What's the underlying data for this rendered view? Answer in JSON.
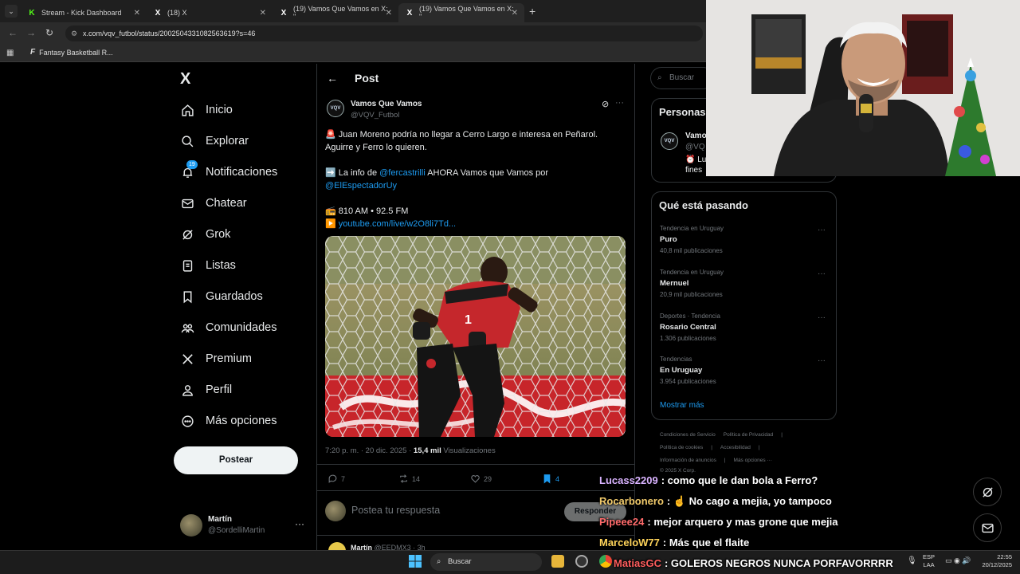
{
  "browser": {
    "tabs": [
      {
        "title": "Stream - Kick Dashboard",
        "favicon": "K"
      },
      {
        "title": "(18) X",
        "favicon": "X"
      },
      {
        "title": "(19) Vamos Que Vamos en X: \"",
        "favicon": "X"
      },
      {
        "title": "(19) Vamos Que Vamos en X: \"",
        "favicon": "X"
      }
    ],
    "url": "x.com/vqv_futbol/status/2002504331082563619?s=46",
    "bookmark": "Fantasy Basketball R..."
  },
  "nav": {
    "logo": "X",
    "items": [
      {
        "label": "Inicio",
        "icon": "home-icon"
      },
      {
        "label": "Explorar",
        "icon": "search-icon"
      },
      {
        "label": "Notificaciones",
        "icon": "bell-icon",
        "badge": "19"
      },
      {
        "label": "Chatear",
        "icon": "mail-icon"
      },
      {
        "label": "Grok",
        "icon": "grok-icon"
      },
      {
        "label": "Listas",
        "icon": "list-icon"
      },
      {
        "label": "Guardados",
        "icon": "bookmark-icon"
      },
      {
        "label": "Comunidades",
        "icon": "communities-icon"
      },
      {
        "label": "Premium",
        "icon": "x-icon"
      },
      {
        "label": "Perfil",
        "icon": "person-icon"
      },
      {
        "label": "Más opciones",
        "icon": "more-circle-icon"
      }
    ],
    "post_button": "Postear",
    "account": {
      "name": "Martín",
      "handle": "@SordelliMartin"
    }
  },
  "post": {
    "header": "Post",
    "author": {
      "name": "Vamos Que Vamos",
      "handle": "@VQV_Futbol",
      "avatar_text": "VQV"
    },
    "line1": "🚨 Juan Moreno podría no llegar a Cerro Largo e interesa en Peñarol.",
    "line2": "Aguirre y Ferro lo quieren.",
    "line3_pre": "➡️ La info de ",
    "line3_link": "@fercastrilli",
    "line3_post": " AHORA Vamos que Vamos por",
    "line4_link": "@ElEspectadorUy",
    "line5": "📻 810 AM • 92.5 FM",
    "line6_pre": "▶️ ",
    "line6_link": "youtube.com/live/w2O8li7Td...",
    "time": "7:20 p. m. · 20 dic. 2025 · ",
    "views_count": "15,4 mil",
    "views_label": " Visualizaciones",
    "replies": "7",
    "reposts": "14",
    "likes": "29",
    "bookmarks": "4",
    "reply_placeholder": "Postea tu respuesta",
    "reply_button": "Responder",
    "next_reply_name": "Martín",
    "next_reply_meta": "@EEDMX3 · 3h"
  },
  "right": {
    "search_placeholder": "Buscar",
    "relevant_title": "Personas",
    "relevant_name": "Vamo",
    "relevant_handle": "@VQ",
    "relevant_line1": "⏰ Lu",
    "relevant_line2": "fines",
    "trends_title": "Qué está pasando",
    "trends": [
      {
        "context": "Tendencia en Uruguay",
        "name": "Puro",
        "count": "40,8 mil publicaciones"
      },
      {
        "context": "Tendencia en Uruguay",
        "name": "Mernuel",
        "count": "20,9 mil publicaciones"
      },
      {
        "context": "Deportes · Tendencia",
        "name": "Rosario Central",
        "count": "1.306 publicaciones"
      },
      {
        "context": "Tendencias",
        "name": "En Uruguay",
        "count": "3.954 publicaciones"
      }
    ],
    "show_more": "Mostrar más",
    "footer1": [
      "Condiciones de Servicio",
      "Política de Privacidad",
      "|"
    ],
    "footer2": [
      "Política de cookies",
      "|",
      "Accesibilidad",
      "|"
    ],
    "footer3": [
      "Información de anuncios",
      "|",
      "Más opciones ···"
    ],
    "footer4": "© 2025 X Corp."
  },
  "chat": [
    {
      "user": "Lucass2209",
      "color": "#d9b3ff",
      "message": ": como que le dan bola a Ferro?"
    },
    {
      "user": "Rocarbonero",
      "color": "#f0c96a",
      "message": ": ☝️ No cago a mejia, yo tampoco"
    },
    {
      "user": "Pipeee24",
      "color": "#ff6b6b",
      "message": ": mejor arquero y mas grone que mejia"
    },
    {
      "user": "MarceloW77",
      "color": "#ffd45a",
      "message": ": Más que el flaite"
    },
    {
      "user": "MatiasGC",
      "color": "#ff5d5d",
      "message": ": GOLEROS NEGROS NUNCA PORFAVORRRR"
    }
  ],
  "taskbar": {
    "search": "Buscar",
    "lang1": "ESP",
    "lang2": "LAA",
    "time": "22:55",
    "date": "20/12/2025"
  },
  "colors": {
    "accent": "#1d9bf0",
    "background": "#000000",
    "text": "#e7e9ea",
    "muted": "#71767b"
  }
}
